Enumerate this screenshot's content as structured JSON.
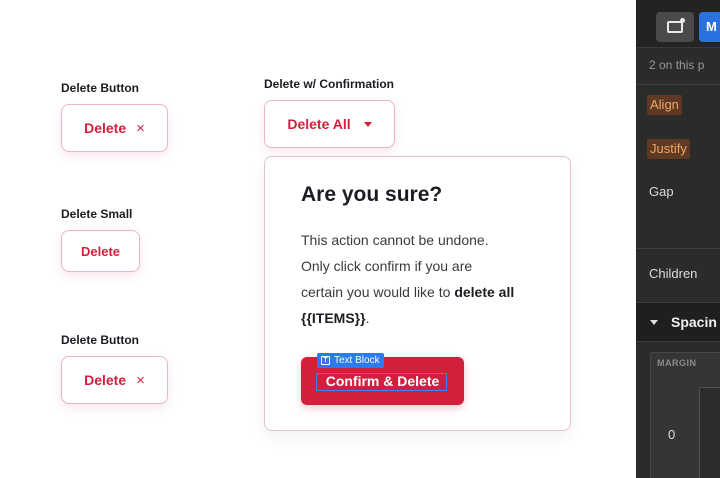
{
  "canvas": {
    "delete_button_label_1": "Delete Button",
    "delete_button_text_1": "Delete",
    "delete_small_label": "Delete Small",
    "delete_small_text": "Delete",
    "delete_button_label_2": "Delete Button",
    "delete_button_text_2": "Delete",
    "confirm_label": "Delete w/ Confirmation",
    "delete_all_text": "Delete All",
    "close_glyph": "×"
  },
  "popover": {
    "title": "Are you sure?",
    "body_line_1": "This action cannot be undone.",
    "body_line_2": "Only click confirm if you are",
    "body_line_3": "certain you would like to",
    "body_bold": "delete all {{ITEMS}}",
    "body_end": ".",
    "confirm_button": "Confirm & Delete",
    "selection_badge": "Text Block"
  },
  "panel": {
    "mode_button_text": "M",
    "selection_count": "2 on this p",
    "align_label": "Align",
    "justify_label": "Justify",
    "gap_label": "Gap",
    "children_label": "Children",
    "spacing_section": "Spacin",
    "margin_label": "MARGIN",
    "margin_value": "0"
  },
  "colors": {
    "danger": "#d21f3c",
    "panel_bg": "#2b2b2b",
    "selection_blue": "#2b7bf0",
    "tag_orange": "#f0a56a"
  },
  "icons": [
    "close-icon",
    "caret-down-icon",
    "text-block-icon",
    "monitor-icon",
    "collapse-triangle-icon"
  ]
}
